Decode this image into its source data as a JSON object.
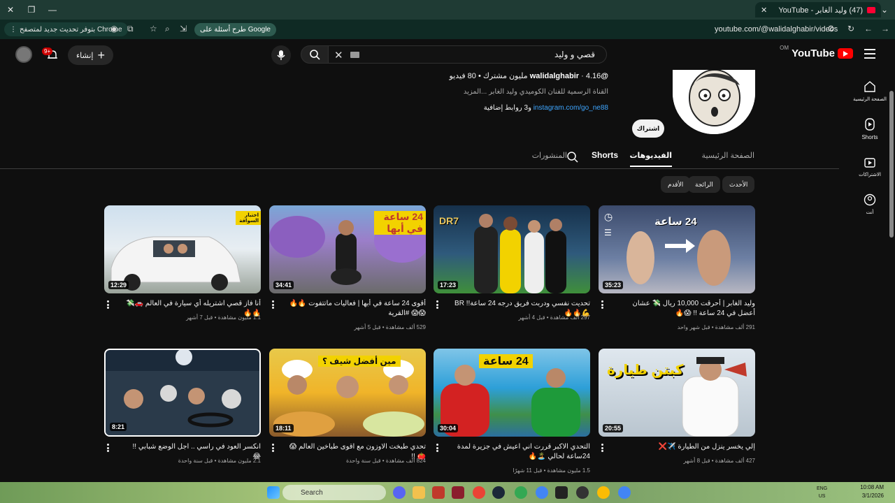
{
  "browser": {
    "tab_title": "(47) وليد الغابر - YouTube",
    "url": "youtube.com/@walidalghabir/videos",
    "update_notice": "بتوفر تحديث جديد لمتصفح Chrome",
    "google_ask": "طرح أسئلة على Google"
  },
  "header": {
    "logo_text": "YouTube",
    "logo_region": "OM",
    "search_query": "قصي و وليد",
    "create_label": "إنشاء",
    "notification_count": "9+"
  },
  "sidebar": {
    "items": [
      {
        "label": "الصفحة الرئيسية",
        "icon": "home-icon"
      },
      {
        "label": "Shorts",
        "icon": "shorts-icon"
      },
      {
        "label": "الاشتراكات",
        "icon": "subscriptions-icon"
      },
      {
        "label": "أنت",
        "icon": "you-icon"
      }
    ]
  },
  "channel": {
    "handle": "@walidalghabir",
    "stats": "4.16 مليون مشترك • 80 فيديو",
    "description": "القناة الرسمية للفنان الكوميدي وليد الغابر ...المزيد",
    "link": "instagram.com/go_ne88",
    "extra_links": "و3 روابط إضافية",
    "subscribe_label": "اشتراك"
  },
  "tabs": {
    "home": "الصفحة الرئيسية",
    "videos": "الفيديوهات",
    "shorts": "Shorts",
    "posts": "المنشورات"
  },
  "chips": {
    "latest": "الأحدث",
    "popular": "الرائجة",
    "oldest": "الأقدم"
  },
  "videos": [
    {
      "title": "وليد الغابر | أحرقت 10,000 ريال 💸 عشان أعضل في 24 ساعة !! 😱🔥",
      "meta": "291 ألف مشاهدة • قبل شهر واحد",
      "duration": "35:23",
      "overlay": "24 ساعة"
    },
    {
      "title": "تحديت نفسي ودربت فريق درجه 24 ساعة!! BR 💪🔥🔥",
      "meta": "297 ألف مشاهدة • قبل 4 أشهر",
      "duration": "17:23",
      "overlay": "DR7"
    },
    {
      "title": "أقوى 24 ساعة في أبها | فعاليات ماتتفوت 🔥🔥😱😱 #القرية",
      "meta": "529 ألف مشاهدة • قبل 5 أشهر",
      "duration": "34:41",
      "overlay": "24 ساعة في أبها"
    },
    {
      "title": "أنا فاز قصي اشتريله أي سيارة في العالم 🚗💸🔥🔥",
      "meta": "1.1 مليون مشاهدة • قبل 7 أشهر",
      "duration": "12:29",
      "overlay": "اختبار السواقة"
    },
    {
      "title": "إلي يخسر ينزل من الطيارة ✈️❌",
      "meta": "427 ألف مشاهدة • قبل 8 أشهر",
      "duration": "20:55",
      "overlay": "كبتن طيارة"
    },
    {
      "title": "التحدي الاكبر قررت اني اعيش في جزيرة لمدة 24ساعة لحالي 🏝️🔥",
      "meta": "1.5 مليون مشاهدة • قبل 11 شهرًا",
      "duration": "30:04",
      "overlay": "24 ساعة"
    },
    {
      "title": "تحدي طبخت الاوزون مع اقوى طباخين العالم 😱🍅 !!",
      "meta": "824 ألف مشاهدة • قبل سنة واحدة",
      "duration": "18:11",
      "overlay": "مين أفضل شيف ؟"
    },
    {
      "title": "انكسر العود في راسي .. اجل الوضع شبابي !! 😂",
      "meta": "2.1 مليون مشاهدة • قبل سنة واحدة",
      "duration": "8:21",
      "overlay": ""
    }
  ],
  "taskbar": {
    "search_label": "Search",
    "lang_line1": "ENG",
    "lang_line2": "US",
    "time": "10:08 AM",
    "date": "3/1/2026"
  }
}
